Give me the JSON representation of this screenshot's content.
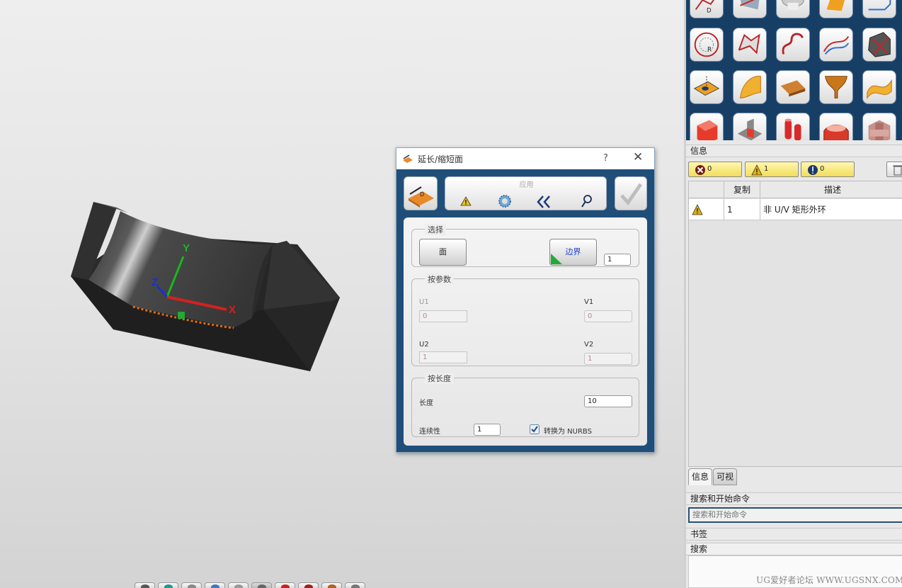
{
  "dialog": {
    "title": "延长/缩短面",
    "help": "?",
    "close": "✕",
    "apply_label": "应用",
    "selection": {
      "group_title": "选择",
      "face_button": "面",
      "boundary_button": "边界",
      "count_value": "1"
    },
    "by_params": {
      "group_title": "按参数",
      "u1_label": "U1",
      "u1_value": "0",
      "v1_label": "V1",
      "v1_value": "0",
      "u2_label": "U2",
      "u2_value": "1",
      "v2_label": "V2",
      "v2_value": "1"
    },
    "by_length": {
      "group_title": "按长度",
      "length_label": "长度",
      "length_value": "10",
      "continuity_label": "连续性",
      "continuity_value": "1",
      "convert_label": "转换为 NURBS",
      "convert_checked": true
    }
  },
  "viewport": {
    "axis_x": "X",
    "axis_y": "Y",
    "axis_z": "Z",
    "colors": {
      "x": "#d42020",
      "y": "#18b820",
      "z": "#1a2fd0",
      "boundary": "#e06a1a"
    }
  },
  "info_panel": {
    "header": "信息",
    "filters": [
      {
        "icon": "error-icon",
        "count": "0"
      },
      {
        "icon": "warning-icon",
        "count": "1"
      },
      {
        "icon": "info-icon",
        "count": "0"
      }
    ],
    "columns": [
      "",
      "复制",
      "描述"
    ],
    "rows": [
      {
        "icon": "warning-icon",
        "copy": "1",
        "desc": "非 U/V 矩形外环"
      }
    ],
    "tabs": [
      "信息",
      "可视"
    ]
  },
  "search": {
    "header": "搜索和开始命令",
    "placeholder": "搜索和开始命令"
  },
  "bookmarks": {
    "header": "书签"
  },
  "search_section": {
    "header": "搜索"
  },
  "watermark": "UG爱好者论坛 WWW.UGSNX.COM",
  "gallery_icons": [
    "curve-on-face-icon",
    "fillet-face-icon",
    "surface-blend-icon",
    "surface-patch-icon",
    "corner-curve-icon",
    "circle-radius-icon",
    "boundary-curve-icon",
    "spline-curve-icon",
    "sweep-curve-icon",
    "box-frame-icon",
    "offset-face-icon",
    "bent-surface-icon",
    "ruled-surface-icon",
    "trumpet-surface-icon",
    "freeform-surface-icon",
    "solid-block-icon",
    "step-block-icon",
    "cylinder-pins-icon",
    "flange-icon",
    "hollow-block-icon"
  ]
}
